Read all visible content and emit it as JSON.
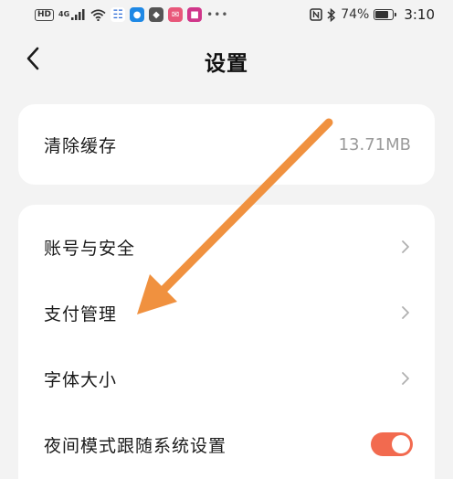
{
  "status_bar": {
    "hd_label": "HD",
    "network_label": "4G",
    "battery_percent": "74%",
    "time": "3:10",
    "battery_level": 0.74,
    "icons": [
      "signal-icon",
      "wifi-icon",
      "nfc-icon",
      "bluetooth-icon",
      "battery-icon"
    ]
  },
  "header": {
    "title": "设置",
    "back_icon": "chevron-left-icon"
  },
  "cache_card": {
    "label": "清除缓存",
    "value": "13.71MB"
  },
  "settings_list": {
    "items": [
      {
        "label": "账号与安全",
        "control": "chevron-right-icon"
      },
      {
        "label": "支付管理",
        "control": "chevron-right-icon"
      },
      {
        "label": "字体大小",
        "control": "chevron-right-icon"
      },
      {
        "label": "夜间模式跟随系统设置",
        "control": "toggle",
        "toggle_on": true
      }
    ]
  },
  "colors": {
    "background": "#f3f3f3",
    "card": "#ffffff",
    "toggle_on": "#f26a4f",
    "annotation_arrow": "#f0913f",
    "secondary_text": "#9a9a9a"
  }
}
